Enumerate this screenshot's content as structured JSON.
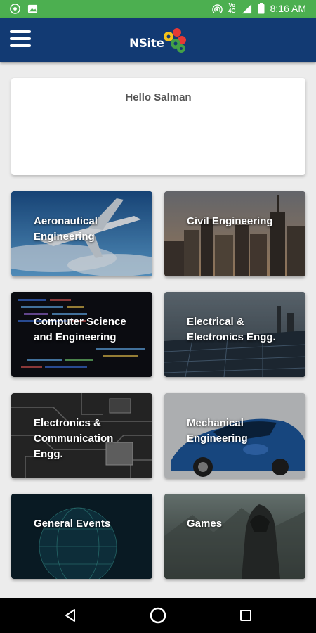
{
  "status_bar": {
    "time": "8:16 AM",
    "network": "4G",
    "volte": "VoLTE",
    "icons": [
      "chrome-icon",
      "image-icon",
      "hotspot-icon",
      "signal-icon",
      "battery-icon"
    ]
  },
  "app_bar": {
    "menu_icon": "hamburger-menu-icon",
    "logo_text": "NSite"
  },
  "greeting": {
    "text": "Hello Salman"
  },
  "tiles": [
    {
      "label": "Aeronautical Engineering"
    },
    {
      "label": "Civil Engineering"
    },
    {
      "label": "Computer Science and Engineering"
    },
    {
      "label": "Electrical & Electronics Engg."
    },
    {
      "label": "Electronics & Communication Engg."
    },
    {
      "label": "Mechanical Engineering"
    },
    {
      "label": "General Events"
    },
    {
      "label": "Games"
    }
  ],
  "nav_bar": {
    "icons": [
      "back-icon",
      "home-icon",
      "recents-icon"
    ]
  },
  "colors": {
    "status_bar": "#4caf50",
    "app_bar": "#123a73",
    "background": "#ececec"
  }
}
